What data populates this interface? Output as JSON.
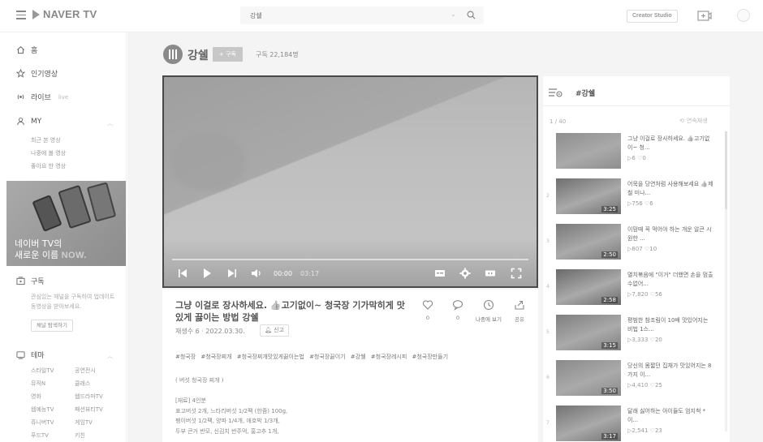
{
  "header": {
    "logo_text": "NAVER TV",
    "search_value": "강쉘",
    "creator_label": "Creator Studio"
  },
  "sidebar": {
    "home": "홈",
    "popular": "인기영상",
    "live": "라이브",
    "live_tag": "live",
    "my": "MY",
    "my_items": [
      "최근 본 영상",
      "나중에 볼 영상",
      "좋아요 한 영상"
    ],
    "banner_line1": "네이버 TV의",
    "banner_line2_a": "새로운 이름",
    "banner_line2_b": "NOW.",
    "subscribe": "구독",
    "subscribe_desc": "관심있는 채널을 구독하여 업데이트 동영상을 받아보세요.",
    "explore_btn": "채널 탐색하기",
    "theme": "테마",
    "themes": [
      "스타일TV",
      "공연전시",
      "뮤직N",
      "클래스",
      "영화",
      "웹드라마TV",
      "웹예능TV",
      "패션뷰티TV",
      "쥬니버TV",
      "게임TV",
      "푸드TV",
      "키친"
    ]
  },
  "channel": {
    "name": "강쉘",
    "follow_label": "+ 구독",
    "subscribers": "구독 22,184명"
  },
  "player": {
    "current_time": "00:00",
    "total_time": "03:17",
    "progress": 0
  },
  "video": {
    "title": "그냥 이걸로 장사하세요. 👍고기없이~ 청국장 기가막히게 맛있게 끓이는 방법 강쉘",
    "meta": "재생수 6 · 2022.03.30.",
    "report": "신고",
    "like_count": "0",
    "comment_count": "0",
    "later_label": "나중에 보기",
    "share_label": "공유",
    "tags": "#청국장 #청국장찌개 #청국장찌개맛있게끓이는법 #청국장끓이기 #강쉘 #청국장레시피 #청국장만들기",
    "desc": [
      "( 버섯 청국장 찌개 )",
      "",
      "[재료] 4인분",
      "표고버섯 2개, 느타리버섯 1/2팩 (한줌) 100g,",
      "팽이버섯 1/2팩, 양파 1/4개, 애호박 1/3개,",
      "두부 큰거 반모, 신김치 반주먹, 홍고추 1개,"
    ]
  },
  "playlist": {
    "title": "#강쉘",
    "count": "1 / 40",
    "autoplay": "연속재생",
    "items": [
      {
        "num": "",
        "title": "그냥 이걸로 장사하세요. 👍고기없이~ 청...",
        "views": "6",
        "likes": "0",
        "duration": ""
      },
      {
        "num": "2",
        "title": "어묵을 당연처럼 사용해보세요 👍제철 미나...",
        "views": "756",
        "likes": "6",
        "duration": "3:25"
      },
      {
        "num": "3",
        "title": "이맘때 꼭 먹어야 하는 개운 알큰 시원한 ...",
        "views": "807",
        "likes": "10",
        "duration": "2:50"
      },
      {
        "num": "4",
        "title": "멸치볶음에 \"이거\" 더했면 손을 멈출수없어...",
        "views": "7,820",
        "likes": "56",
        "duration": "2:58"
      },
      {
        "num": "5",
        "title": "평범한 참조림이 10배 맛있어지는 비법 1스...",
        "views": "3,333",
        "likes": "20",
        "duration": "3:15"
      },
      {
        "num": "6",
        "title": "당신의 몸짧던 집채가 맛있어지는 8가지 이...",
        "views": "4,410",
        "likes": "25",
        "duration": "3:50"
      },
      {
        "num": "7",
        "title": "달래 싫어하는 아이들도 엄지척 *이...",
        "views": "2,541",
        "likes": "23",
        "duration": "3:17"
      }
    ]
  }
}
